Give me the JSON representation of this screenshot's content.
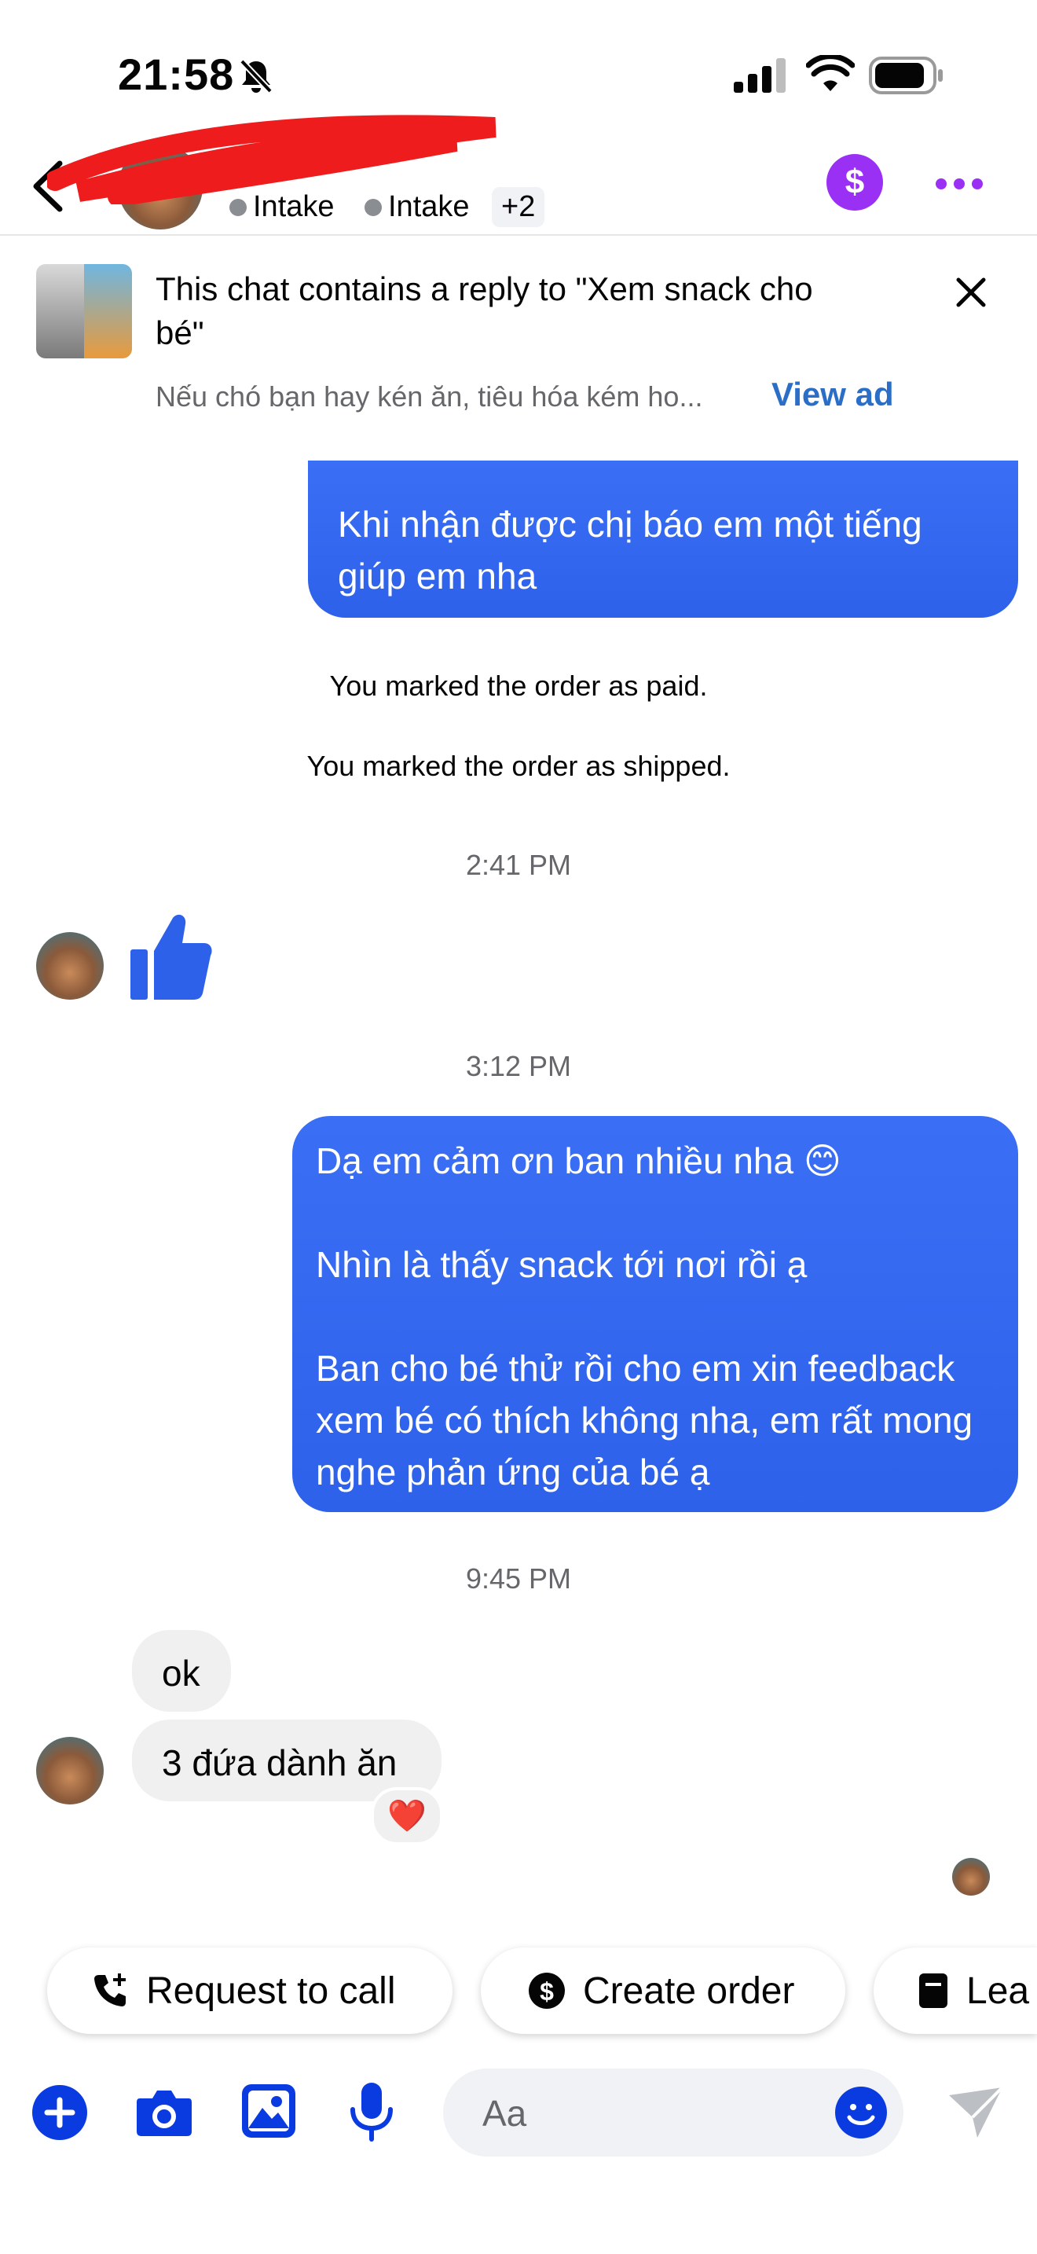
{
  "status_bar": {
    "time": "21:58"
  },
  "header": {
    "tags": [
      "Intake",
      "Intake"
    ],
    "more_tags": "+2"
  },
  "ad_banner": {
    "text": "This chat contains a reply to \"Xem snack cho bé\"",
    "subtext": "Nếu chó bạn hay kén ăn, tiêu hóa kém ho...",
    "view_ad": "View ad"
  },
  "messages": {
    "out_1": "Khi nhận được chị báo em một tiếng giúp em nha",
    "sys_paid": "You marked the order as paid.",
    "sys_shipped": "You marked the order as shipped.",
    "ts_1": "2:41 PM",
    "ts_2": "3:12 PM",
    "out_2_line1": "Dạ em cảm ơn ban nhiều nha 😊",
    "out_2_line2": "Nhìn là thấy snack tới nơi rồi ạ",
    "out_2_line3": "Ban cho bé thử rồi cho em xin feedback xem bé có thích không nha, em rất mong nghe phản ứng của bé ạ",
    "ts_3": "9:45 PM",
    "in_1": "ok",
    "in_2": "3 đứa dành ăn",
    "reaction": "❤️"
  },
  "quick_replies": [
    "Request to call",
    "Create order",
    "Lea"
  ],
  "composer": {
    "placeholder": "Aa"
  },
  "colors": {
    "accent_blue": "#2e61ea",
    "messenger_icon_blue": "#0a3be0",
    "dollar_purple": "#9b30f5"
  }
}
